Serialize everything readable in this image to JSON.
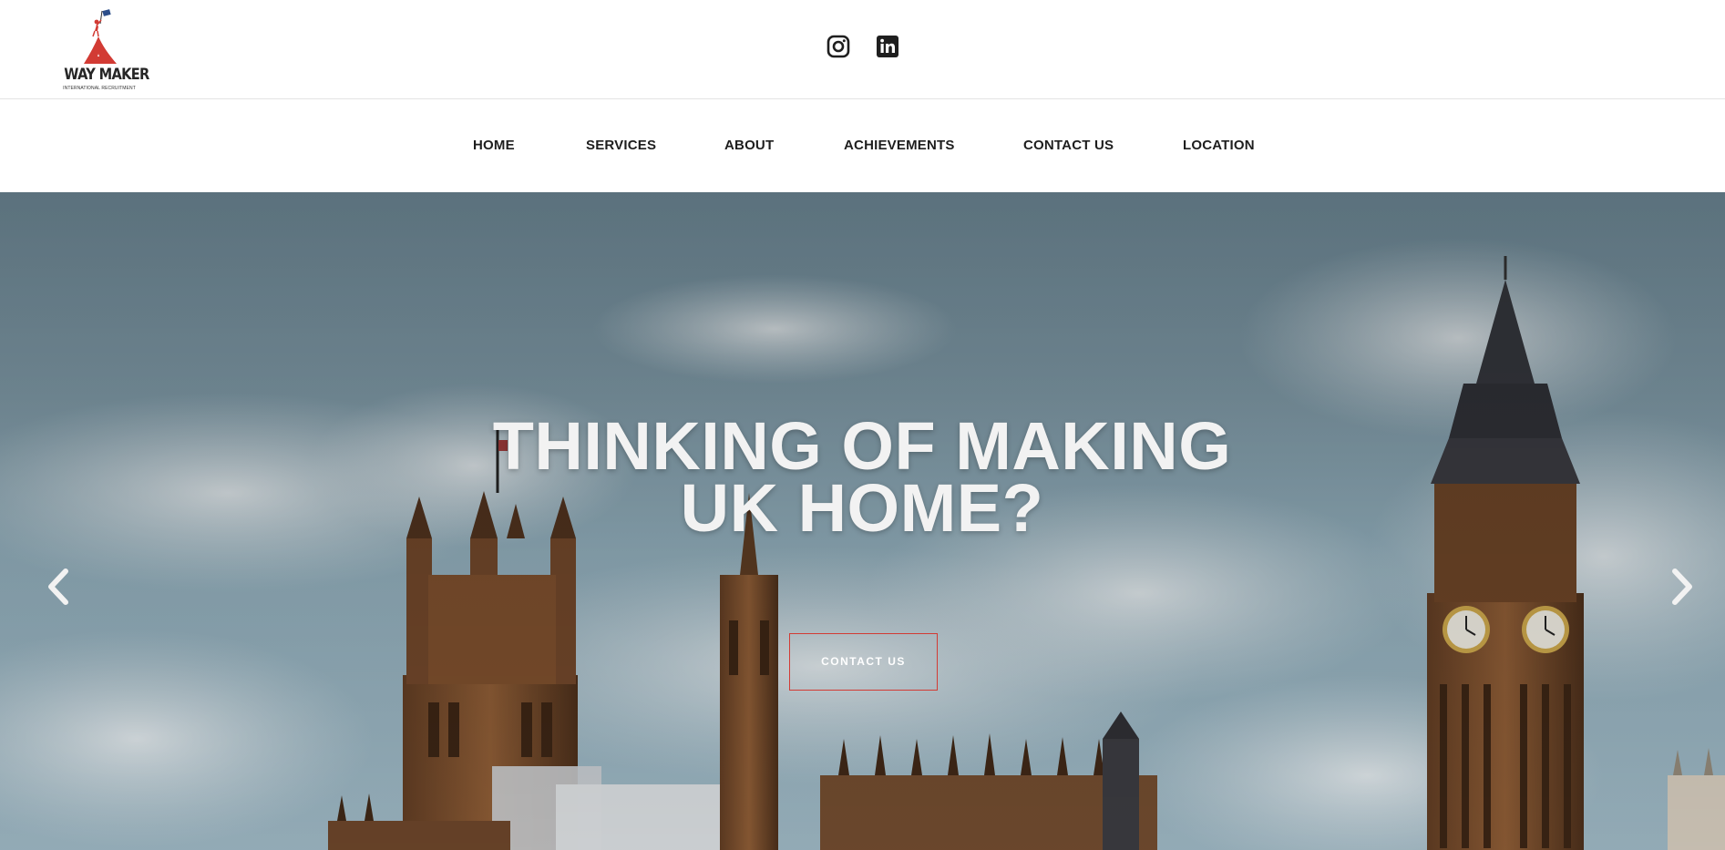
{
  "brand": {
    "name": "WAY MAKER",
    "tagline": "INTERNATIONAL RECRUITMENT",
    "accent_color": "#d23b34",
    "flag_color": "#2c4e8a"
  },
  "social": [
    {
      "name": "instagram-icon"
    },
    {
      "name": "linkedin-icon"
    }
  ],
  "nav": {
    "items": [
      {
        "label": "HOME"
      },
      {
        "label": "SERVICES"
      },
      {
        "label": "ABOUT"
      },
      {
        "label": "ACHIEVEMENTS"
      },
      {
        "label": "CONTACT US"
      },
      {
        "label": "LOCATION"
      }
    ]
  },
  "hero": {
    "title_line1": "THINKING OF MAKING",
    "title_line2": "UK HOME?",
    "cta_label": "CONTACT US",
    "prev_icon": "chevron-left-icon",
    "next_icon": "chevron-right-icon"
  }
}
